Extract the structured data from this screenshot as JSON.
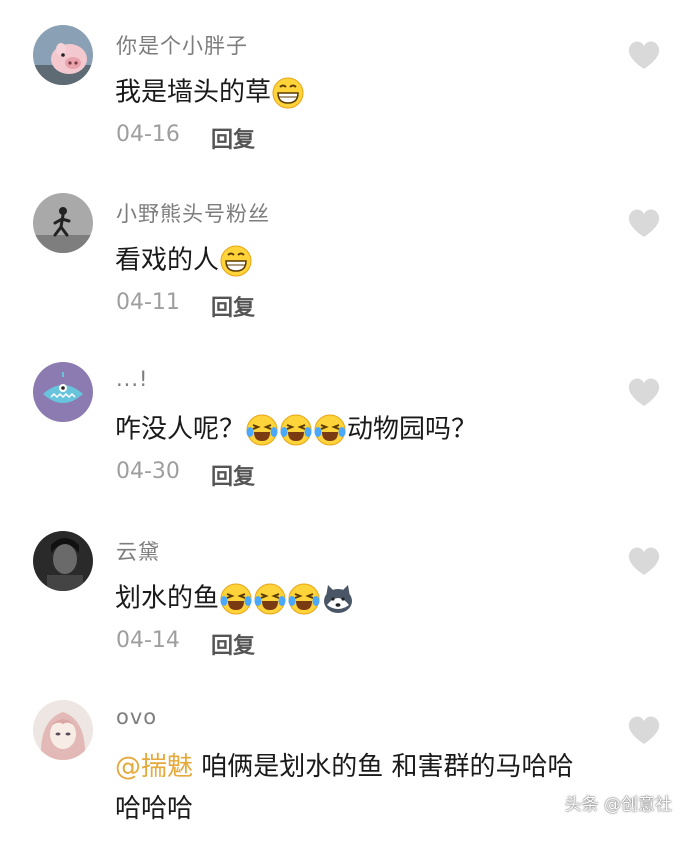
{
  "comments": [
    {
      "username": "你是个小胖子",
      "text_before": "我是墙头的草",
      "emojis": [
        "grin-emoji"
      ],
      "date": "04-16",
      "reply_label": "回复"
    },
    {
      "username": "小野熊头号粉丝",
      "text_before": "看戏的人",
      "emojis": [
        "grin-emoji"
      ],
      "date": "04-11",
      "reply_label": "回复"
    },
    {
      "username": "...!",
      "text_before": "咋没人呢？",
      "emojis": [
        "laugh-cry-emoji",
        "laugh-cry-emoji",
        "laugh-cry-emoji"
      ],
      "text_after": "动物园吗？",
      "date": "04-30",
      "reply_label": "回复"
    },
    {
      "username": "云黛",
      "text_before": "划水的鱼",
      "emojis": [
        "laugh-cry-emoji",
        "laugh-cry-emoji",
        "laugh-cry-emoji",
        "husky-emoji"
      ],
      "date": "04-14",
      "reply_label": "回复"
    },
    {
      "username": "ovo",
      "mention": "@揣魅",
      "text_before": " 咱俩是划水的鱼 和害群的马哈哈哈哈哈",
      "emojis": []
    }
  ],
  "watermark": "头条 @创意社",
  "colors": {
    "mention": "#e5a93c",
    "like_heart": "#d9d9d9",
    "username": "#7d7d7d"
  }
}
